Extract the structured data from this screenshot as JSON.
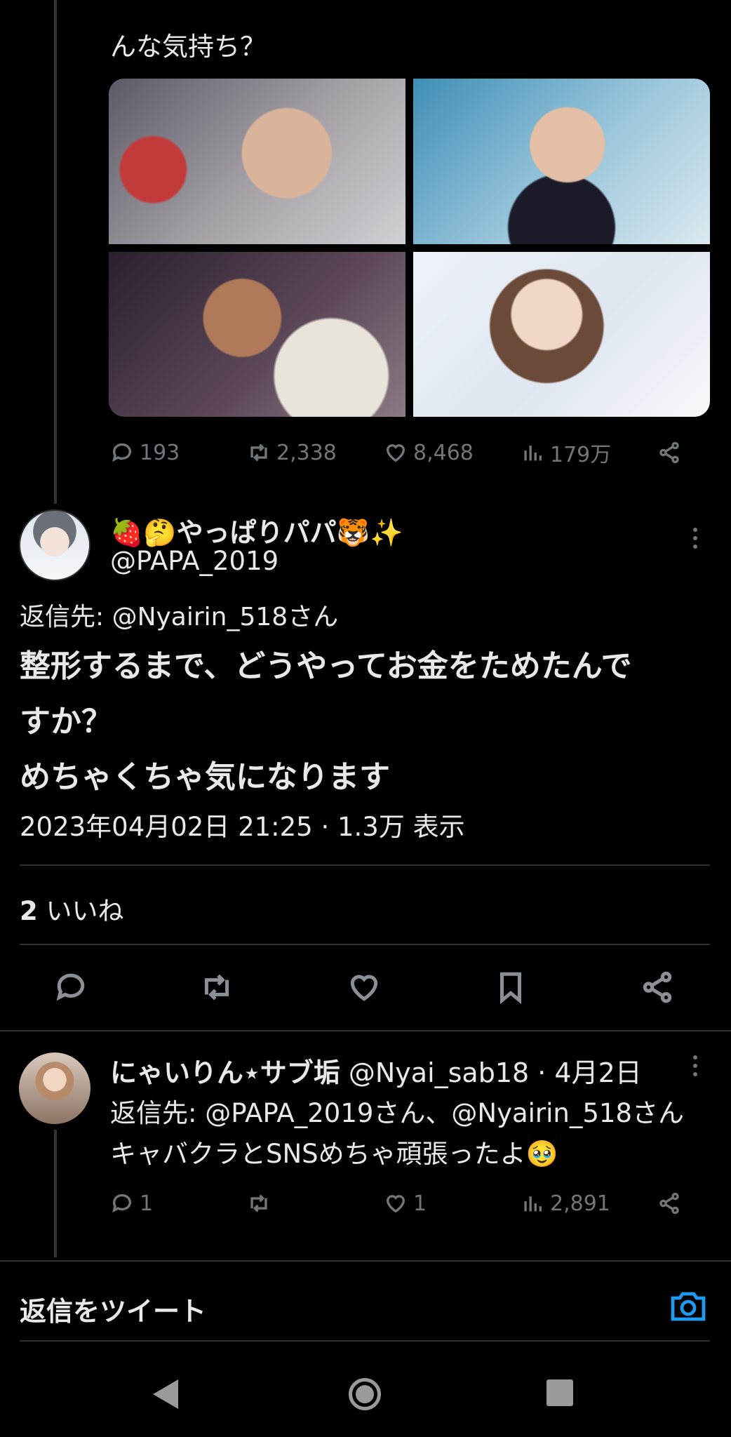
{
  "parent_tweet": {
    "text_fragment": "んな気持ち？",
    "stats": {
      "replies": "193",
      "retweets": "2,338",
      "likes": "8,468",
      "views": "179万"
    },
    "media_count": 4
  },
  "focused_tweet": {
    "display_name": "🍓🤔やっぱりパパ🐯✨",
    "handle": "@PAPA_2019",
    "replying_to": "返信先: @Nyairin_518さん",
    "body_lines": [
      "整形するまで、どうやってお金をためたんで",
      "すか？",
      "めちゃくちゃ気になります"
    ],
    "timestamp": "2023年04月02日 21:25 · 1.3万 表示",
    "like_count": "2",
    "like_label": " いいね"
  },
  "reply_tweet": {
    "display_name": "にゃいりん⋆サブ垢",
    "meta": " @Nyai_sab18 · 4月2日",
    "replying_to": "返信先: @PAPA_2019さん、@Nyairin_518さん",
    "body": "キャバクラとSNSめちゃ頑張ったよ🥹",
    "stats": {
      "replies": "1",
      "retweets": "",
      "likes": "1",
      "views": "2,891"
    }
  },
  "composer": {
    "placeholder": "返信をツイート"
  },
  "colors": {
    "background": "#000000",
    "text": "#e7e9ea",
    "muted": "#71767b",
    "accent": "#1d9bf0",
    "divider": "#2f3336"
  },
  "icons": [
    "reply-icon",
    "retweet-icon",
    "like-icon",
    "views-icon",
    "share-icon",
    "bookmark-icon",
    "camera-icon",
    "more-icon"
  ]
}
